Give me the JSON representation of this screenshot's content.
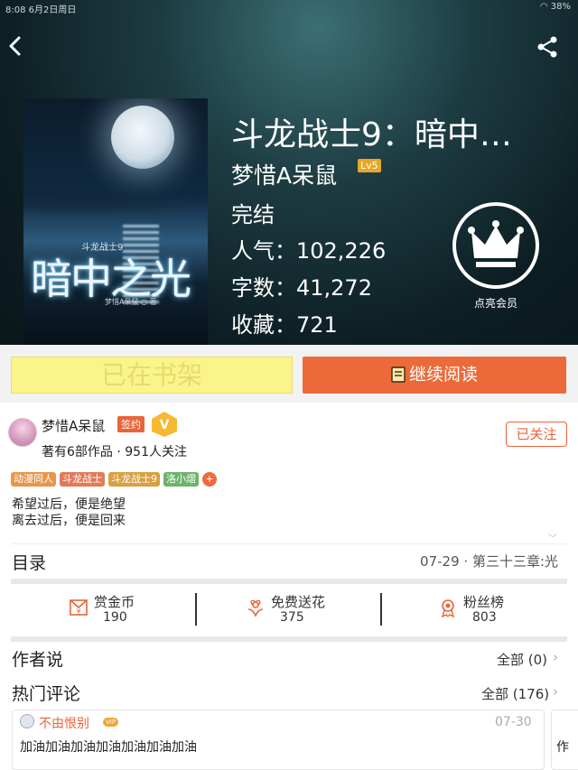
{
  "status_bar": {
    "time": "8:08",
    "date": "6月2日周日",
    "battery": "38%"
  },
  "book": {
    "title": "斗龙战士9：暗中…",
    "author": "梦惜A呆鼠",
    "author_level": "Lv5",
    "status": "完结",
    "popularity": "人气：102,226",
    "word_count": "字数：41,272",
    "favorites": "收藏：721",
    "cover": {
      "title": "暗中之光",
      "subtitle": "斗龙战士9",
      "author": "梦惜A呆鼠 ○ 著"
    }
  },
  "vip": {
    "label": "点亮会员"
  },
  "buttons": {
    "on_shelf": "已在书架",
    "continue_reading": "继续阅读"
  },
  "author_card": {
    "name": "梦惜A呆鼠",
    "signed_badge": "签约",
    "info": "著有6部作品 · 951人关注",
    "follow_label": "已关注"
  },
  "tags": [
    {
      "label": "动漫同人",
      "color": "#e8964a"
    },
    {
      "label": "斗龙战士",
      "color": "#e07a5a"
    },
    {
      "label": "斗龙战士9",
      "color": "#d6a043"
    },
    {
      "label": "洛小熠",
      "color": "#6cb36a"
    }
  ],
  "tag_more": "+",
  "description": [
    "希望过后，便是绝望",
    "离去过后，便是回来"
  ],
  "toc": {
    "label": "目录",
    "latest": "07-29 · 第三十三章:光"
  },
  "stats": [
    {
      "label": "赏金币",
      "value": "190",
      "icon": "coin-envelope-icon"
    },
    {
      "label": "免费送花",
      "value": "375",
      "icon": "flower-icon"
    },
    {
      "label": "粉丝榜",
      "value": "803",
      "icon": "ribbon-medal-icon"
    }
  ],
  "author_says": {
    "label": "作者说",
    "link": "全部 (0)"
  },
  "hot_comments": {
    "label": "热门评论",
    "link": "全部 (176)"
  },
  "comment": {
    "user": "不由恨别",
    "vip": "VIP",
    "date": "07-30",
    "text": "加油加油加油加油加油加油加油",
    "next_preview": "作"
  },
  "colors": {
    "accent": "#ec6a3a",
    "shelf_button": "#fbf48a",
    "hero_bg": "#0d1f24"
  }
}
